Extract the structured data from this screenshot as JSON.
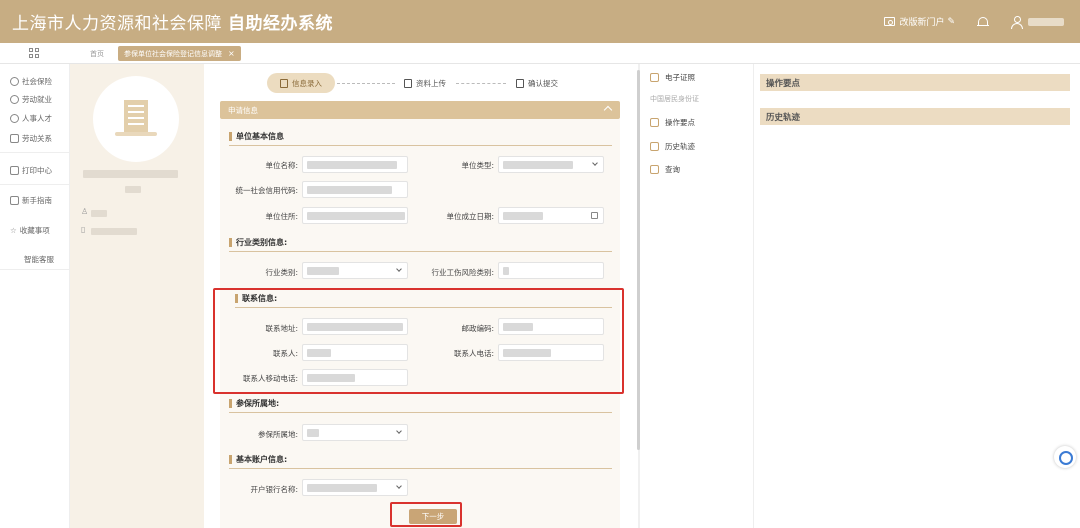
{
  "header": {
    "title_main": "上海市人力资源和社会保障",
    "title_bold": "自助经办系统",
    "portal_link": "改版新门户"
  },
  "tabs": {
    "home": "首页",
    "active": "参保单位社会保险登记信息调整"
  },
  "nav": {
    "items": [
      "社会保险",
      "劳动就业",
      "人事人才",
      "劳动关系",
      "打印中心",
      "新手指南",
      "收藏事项",
      "智能客服"
    ]
  },
  "steps": [
    "信息录入",
    "资料上传",
    "确认提交"
  ],
  "form": {
    "panel_title": "申请信息",
    "sections": {
      "basic": "单位基本信息",
      "industry": "行业类别信息:",
      "contact": "联系信息:",
      "insured": "参保所属地:",
      "account": "基本账户信息:"
    },
    "labels": {
      "unit_name": "单位名称:",
      "unit_type": "单位类型:",
      "credit_code": "统一社会信用代码:",
      "address": "单位住所:",
      "established": "单位成立日期:",
      "industry_type": "行业类别:",
      "risk_type": "行业工伤风险类别:",
      "contact_address": "联系地址:",
      "postal_code": "邮政编码:",
      "contact_person": "联系人:",
      "contact_phone": "联系人电话:",
      "contact_mobile": "联系人移动电话:",
      "insured_place": "参保所属地:",
      "bank_name": "开户银行名称:"
    },
    "next_button": "下一步"
  },
  "side": {
    "cert": "电子证照",
    "cert_sub": "中国居民身份证",
    "ops": "操作要点",
    "history": "历史轨迹",
    "query": "查询"
  },
  "far": {
    "ops": "操作要点",
    "history": "历史轨迹"
  }
}
